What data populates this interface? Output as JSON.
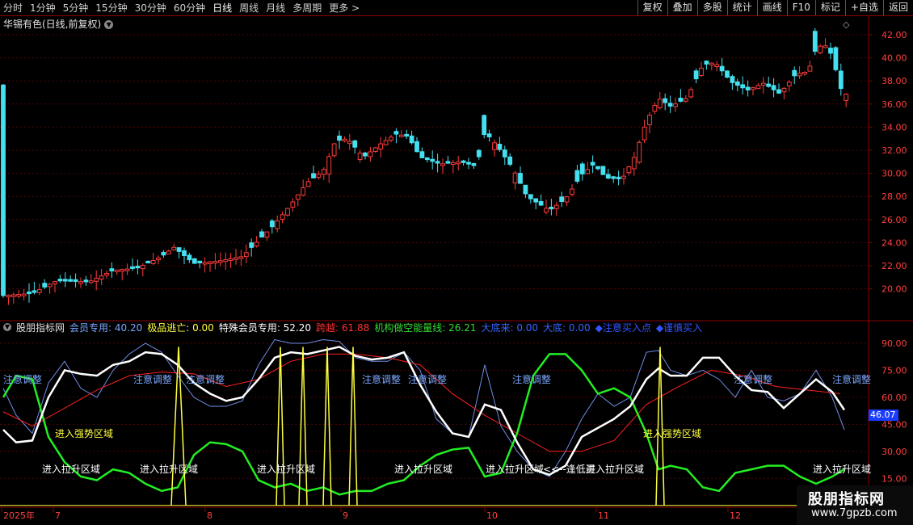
{
  "toolbar": {
    "periods": [
      "分时",
      "1分钟",
      "5分钟",
      "15分钟",
      "30分钟",
      "60分钟",
      "日线",
      "周线",
      "月线",
      "多周期",
      "更多 >"
    ],
    "active_period": "日线",
    "buttons": [
      "复权",
      "叠加",
      "多股",
      "统计",
      "画线",
      "F10",
      "标记",
      "+自选",
      "返回"
    ]
  },
  "stock": {
    "title": "华锡有色(日线,前复权)"
  },
  "indicator": {
    "name": "股朋指标网",
    "items": [
      {
        "text": "会员专用: 40.20",
        "color": "#7aa7ff"
      },
      {
        "text": "极品逃亡: 0.00",
        "color": "#ffff40"
      },
      {
        "text": "特殊会员专用: 52.20",
        "color": "#ffffff"
      },
      {
        "text": "跨越: 61.88",
        "color": "#ff3030"
      },
      {
        "text": "机构做空能量线: 26.21",
        "color": "#33dd33"
      },
      {
        "text": "大底来: 0.00",
        "color": "#3366ff"
      },
      {
        "text": "大底: 0.00",
        "color": "#3366ff"
      },
      {
        "text": "◆注意买入点",
        "color": "#3355ff"
      },
      {
        "text": "◆谨慎买入",
        "color": "#3355ff"
      }
    ]
  },
  "price_axis": [
    "42.00",
    "40.00",
    "38.00",
    "36.00",
    "34.00",
    "32.00",
    "30.00",
    "28.00",
    "26.00",
    "24.00",
    "22.00",
    "20.00"
  ],
  "ind_axis": [
    "90.00",
    "75.00",
    "60.00",
    "45.00",
    "30.00",
    "15.00"
  ],
  "ind_current": "46.07",
  "x_labels": [
    "2025年",
    "7",
    "8",
    "9",
    "10",
    "11",
    "12"
  ],
  "annotations": {
    "adjust": [
      "注意调整",
      "注意调整",
      "注意调整",
      "注意调整",
      "注意调整",
      "注意调整",
      "注意调整",
      "注意调整"
    ],
    "lift": [
      "进入拉升区域",
      "进入拉升区域",
      "进入拉升区域",
      "进入拉升区域",
      "进入拉升区域",
      "进入拉升区域",
      "进入拉升区域"
    ],
    "strong": [
      "进入强势区域",
      "进入强势区域"
    ],
    "bottom": "<<--逢低买"
  },
  "watermark": {
    "line1": "股朋指标网",
    "line2": "www.7gpzb.com"
  },
  "colors": {
    "up": "#ff3b3b",
    "down": "#44e0f0",
    "grid": "#8b0000"
  }
}
